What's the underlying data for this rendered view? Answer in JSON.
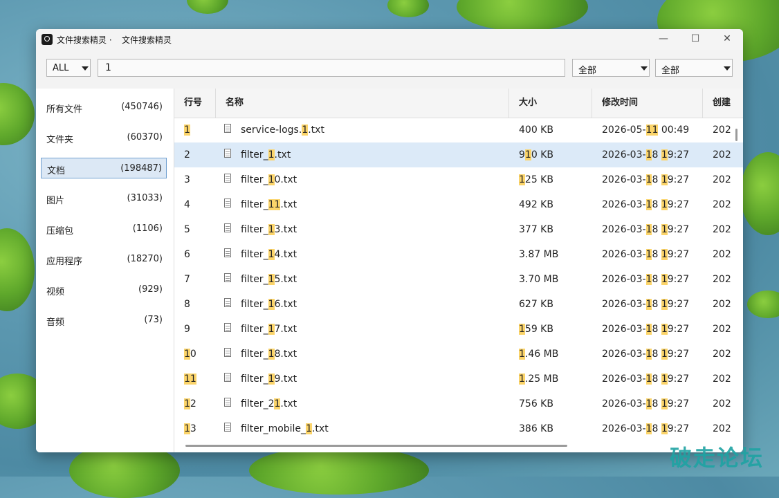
{
  "window": {
    "title": "文件搜索精灵 ·",
    "tab_title": "文件搜索精灵",
    "minimize_glyph": "—",
    "maximize_glyph": "☐",
    "close_glyph": "✕"
  },
  "toolbar": {
    "scope_value": "ALL",
    "search_value": "1",
    "filter1_value": "全部",
    "filter2_value": "全部"
  },
  "sidebar": {
    "items": [
      {
        "label": "所有文件",
        "count": "(450746)"
      },
      {
        "label": "文件夹",
        "count": "(60370)"
      },
      {
        "label": "文档",
        "count": "(198487)"
      },
      {
        "label": "图片",
        "count": "(31033)"
      },
      {
        "label": "压缩包",
        "count": "(1106)"
      },
      {
        "label": "应用程序",
        "count": "(18270)"
      },
      {
        "label": "视频",
        "count": "(929)"
      },
      {
        "label": "音频",
        "count": "(73)"
      }
    ],
    "active_index": 2
  },
  "table": {
    "columns": [
      "行号",
      "名称",
      "大小",
      "修改时间",
      "创建"
    ],
    "rows": [
      {
        "no": "1",
        "name": "service-logs.1.txt",
        "size": "400 KB",
        "mtime": "2026-05-11 00:49",
        "ctime": "202"
      },
      {
        "no": "2",
        "name": "filter_1.txt",
        "size": "910 KB",
        "mtime": "2026-03-18 19:27",
        "ctime": "202"
      },
      {
        "no": "3",
        "name": "filter_10.txt",
        "size": "125 KB",
        "mtime": "2026-03-18 19:27",
        "ctime": "202"
      },
      {
        "no": "4",
        "name": "filter_11.txt",
        "size": "492 KB",
        "mtime": "2026-03-18 19:27",
        "ctime": "202"
      },
      {
        "no": "5",
        "name": "filter_13.txt",
        "size": "377 KB",
        "mtime": "2026-03-18 19:27",
        "ctime": "202"
      },
      {
        "no": "6",
        "name": "filter_14.txt",
        "size": "3.87 MB",
        "mtime": "2026-03-18 19:27",
        "ctime": "202"
      },
      {
        "no": "7",
        "name": "filter_15.txt",
        "size": "3.70 MB",
        "mtime": "2026-03-18 19:27",
        "ctime": "202"
      },
      {
        "no": "8",
        "name": "filter_16.txt",
        "size": "627 KB",
        "mtime": "2026-03-18 19:27",
        "ctime": "202"
      },
      {
        "no": "9",
        "name": "filter_17.txt",
        "size": "159 KB",
        "mtime": "2026-03-18 19:27",
        "ctime": "202"
      },
      {
        "no": "10",
        "name": "filter_18.txt",
        "size": "1.46 MB",
        "mtime": "2026-03-18 19:27",
        "ctime": "202"
      },
      {
        "no": "11",
        "name": "filter_19.txt",
        "size": "1.25 MB",
        "mtime": "2026-03-18 19:27",
        "ctime": "202"
      },
      {
        "no": "12",
        "name": "filter_21.txt",
        "size": "756 KB",
        "mtime": "2026-03-18 19:27",
        "ctime": "202"
      },
      {
        "no": "13",
        "name": "filter_mobile_1.txt",
        "size": "386 KB",
        "mtime": "2026-03-18 19:27",
        "ctime": "202"
      }
    ],
    "selected_index": 1,
    "highlight_term": "1",
    "highlight_color": "#fbd46a"
  },
  "watermark": "破走论坛"
}
